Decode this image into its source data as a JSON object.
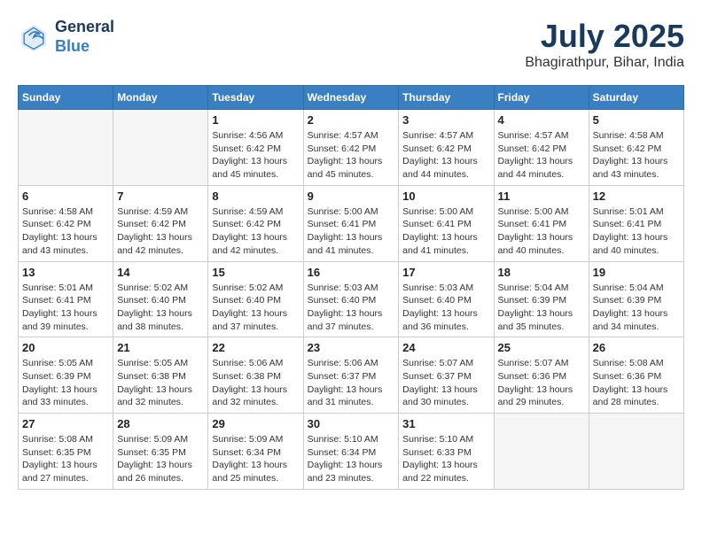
{
  "header": {
    "logo_line1": "General",
    "logo_line2": "Blue",
    "month": "July 2025",
    "location": "Bhagirathpur, Bihar, India"
  },
  "weekdays": [
    "Sunday",
    "Monday",
    "Tuesday",
    "Wednesday",
    "Thursday",
    "Friday",
    "Saturday"
  ],
  "weeks": [
    [
      {
        "day": "",
        "text": ""
      },
      {
        "day": "",
        "text": ""
      },
      {
        "day": "1",
        "text": "Sunrise: 4:56 AM\nSunset: 6:42 PM\nDaylight: 13 hours and 45 minutes."
      },
      {
        "day": "2",
        "text": "Sunrise: 4:57 AM\nSunset: 6:42 PM\nDaylight: 13 hours and 45 minutes."
      },
      {
        "day": "3",
        "text": "Sunrise: 4:57 AM\nSunset: 6:42 PM\nDaylight: 13 hours and 44 minutes."
      },
      {
        "day": "4",
        "text": "Sunrise: 4:57 AM\nSunset: 6:42 PM\nDaylight: 13 hours and 44 minutes."
      },
      {
        "day": "5",
        "text": "Sunrise: 4:58 AM\nSunset: 6:42 PM\nDaylight: 13 hours and 43 minutes."
      }
    ],
    [
      {
        "day": "6",
        "text": "Sunrise: 4:58 AM\nSunset: 6:42 PM\nDaylight: 13 hours and 43 minutes."
      },
      {
        "day": "7",
        "text": "Sunrise: 4:59 AM\nSunset: 6:42 PM\nDaylight: 13 hours and 42 minutes."
      },
      {
        "day": "8",
        "text": "Sunrise: 4:59 AM\nSunset: 6:42 PM\nDaylight: 13 hours and 42 minutes."
      },
      {
        "day": "9",
        "text": "Sunrise: 5:00 AM\nSunset: 6:41 PM\nDaylight: 13 hours and 41 minutes."
      },
      {
        "day": "10",
        "text": "Sunrise: 5:00 AM\nSunset: 6:41 PM\nDaylight: 13 hours and 41 minutes."
      },
      {
        "day": "11",
        "text": "Sunrise: 5:00 AM\nSunset: 6:41 PM\nDaylight: 13 hours and 40 minutes."
      },
      {
        "day": "12",
        "text": "Sunrise: 5:01 AM\nSunset: 6:41 PM\nDaylight: 13 hours and 40 minutes."
      }
    ],
    [
      {
        "day": "13",
        "text": "Sunrise: 5:01 AM\nSunset: 6:41 PM\nDaylight: 13 hours and 39 minutes."
      },
      {
        "day": "14",
        "text": "Sunrise: 5:02 AM\nSunset: 6:40 PM\nDaylight: 13 hours and 38 minutes."
      },
      {
        "day": "15",
        "text": "Sunrise: 5:02 AM\nSunset: 6:40 PM\nDaylight: 13 hours and 37 minutes."
      },
      {
        "day": "16",
        "text": "Sunrise: 5:03 AM\nSunset: 6:40 PM\nDaylight: 13 hours and 37 minutes."
      },
      {
        "day": "17",
        "text": "Sunrise: 5:03 AM\nSunset: 6:40 PM\nDaylight: 13 hours and 36 minutes."
      },
      {
        "day": "18",
        "text": "Sunrise: 5:04 AM\nSunset: 6:39 PM\nDaylight: 13 hours and 35 minutes."
      },
      {
        "day": "19",
        "text": "Sunrise: 5:04 AM\nSunset: 6:39 PM\nDaylight: 13 hours and 34 minutes."
      }
    ],
    [
      {
        "day": "20",
        "text": "Sunrise: 5:05 AM\nSunset: 6:39 PM\nDaylight: 13 hours and 33 minutes."
      },
      {
        "day": "21",
        "text": "Sunrise: 5:05 AM\nSunset: 6:38 PM\nDaylight: 13 hours and 32 minutes."
      },
      {
        "day": "22",
        "text": "Sunrise: 5:06 AM\nSunset: 6:38 PM\nDaylight: 13 hours and 32 minutes."
      },
      {
        "day": "23",
        "text": "Sunrise: 5:06 AM\nSunset: 6:37 PM\nDaylight: 13 hours and 31 minutes."
      },
      {
        "day": "24",
        "text": "Sunrise: 5:07 AM\nSunset: 6:37 PM\nDaylight: 13 hours and 30 minutes."
      },
      {
        "day": "25",
        "text": "Sunrise: 5:07 AM\nSunset: 6:36 PM\nDaylight: 13 hours and 29 minutes."
      },
      {
        "day": "26",
        "text": "Sunrise: 5:08 AM\nSunset: 6:36 PM\nDaylight: 13 hours and 28 minutes."
      }
    ],
    [
      {
        "day": "27",
        "text": "Sunrise: 5:08 AM\nSunset: 6:35 PM\nDaylight: 13 hours and 27 minutes."
      },
      {
        "day": "28",
        "text": "Sunrise: 5:09 AM\nSunset: 6:35 PM\nDaylight: 13 hours and 26 minutes."
      },
      {
        "day": "29",
        "text": "Sunrise: 5:09 AM\nSunset: 6:34 PM\nDaylight: 13 hours and 25 minutes."
      },
      {
        "day": "30",
        "text": "Sunrise: 5:10 AM\nSunset: 6:34 PM\nDaylight: 13 hours and 23 minutes."
      },
      {
        "day": "31",
        "text": "Sunrise: 5:10 AM\nSunset: 6:33 PM\nDaylight: 13 hours and 22 minutes."
      },
      {
        "day": "",
        "text": ""
      },
      {
        "day": "",
        "text": ""
      }
    ]
  ]
}
